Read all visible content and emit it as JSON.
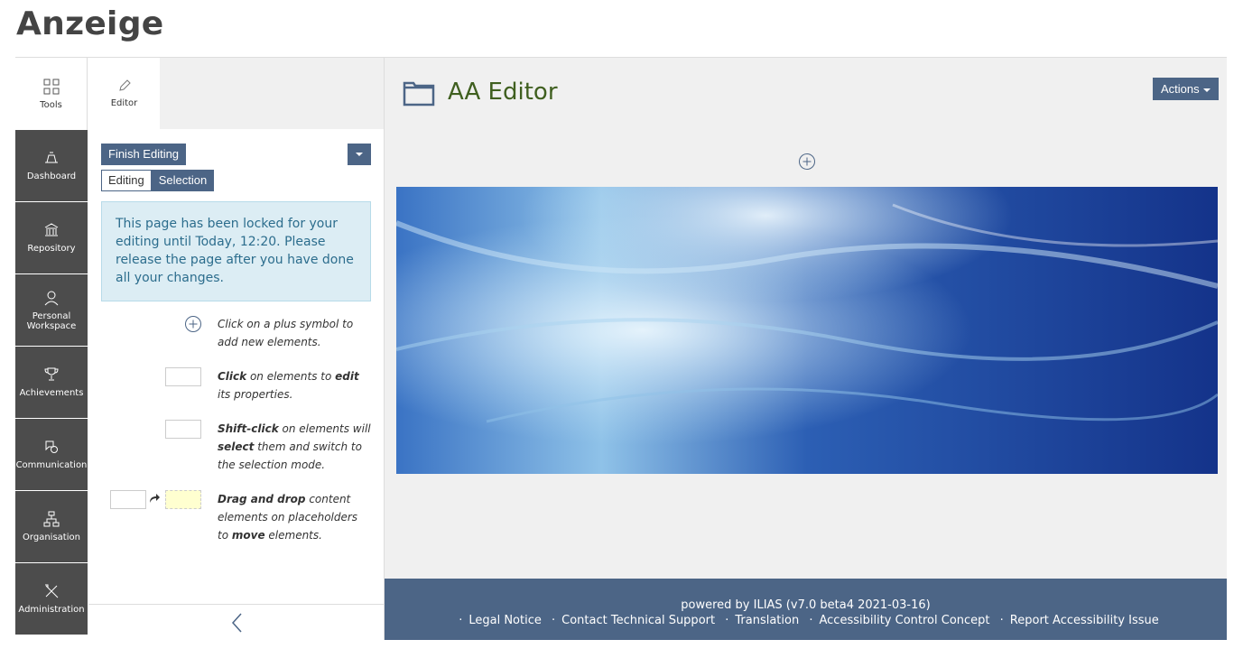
{
  "page_title": "Anzeige",
  "mainbar": {
    "tools_label": "Tools",
    "items": [
      {
        "label": "Dashboard",
        "icon": "dashboard-icon"
      },
      {
        "label": "Repository",
        "icon": "repository-icon"
      },
      {
        "label": "Personal Workspace",
        "icon": "person-icon"
      },
      {
        "label": "Achievements",
        "icon": "trophy-icon"
      },
      {
        "label": "Communication",
        "icon": "chat-icon"
      },
      {
        "label": "Organisation",
        "icon": "org-chart-icon"
      },
      {
        "label": "Administration",
        "icon": "tools-icon"
      }
    ]
  },
  "slate": {
    "tab_label": "Editor",
    "finish_label": "Finish Editing",
    "mode_editing": "Editing",
    "mode_selection": "Selection",
    "lock_info": "This page has been locked for your editing until Today, 12:20. Please release the page after you have done all your changes.",
    "help": [
      {
        "pre": "",
        "strong": "",
        "rest": "Click on a plus symbol to add new elements."
      },
      {
        "strong": "Click",
        "mid": " on elements to ",
        "strong2": "edit",
        "rest": " its properties."
      },
      {
        "strong": "Shift-click",
        "mid": " on elements will ",
        "strong2": "select",
        "rest": " them and switch to the selection mode."
      },
      {
        "strong": "Drag and drop",
        "mid": " content elements on placeholders to ",
        "strong2": "move",
        "rest": " elements."
      }
    ]
  },
  "content": {
    "title": "AA Editor",
    "actions_label": "Actions"
  },
  "footer": {
    "powered": "powered by ILIAS (v7.0 beta4 2021-03-16)",
    "links": [
      "Legal Notice",
      "Contact Technical Support",
      "Translation",
      "Accessibility Control Concept",
      "Report Accessibility Issue"
    ]
  },
  "colors": {
    "primary": "#4c6586",
    "mainbar_bg": "#4c4c4c",
    "info_bg": "#dcedf4",
    "title_green": "#3f5f1f"
  }
}
